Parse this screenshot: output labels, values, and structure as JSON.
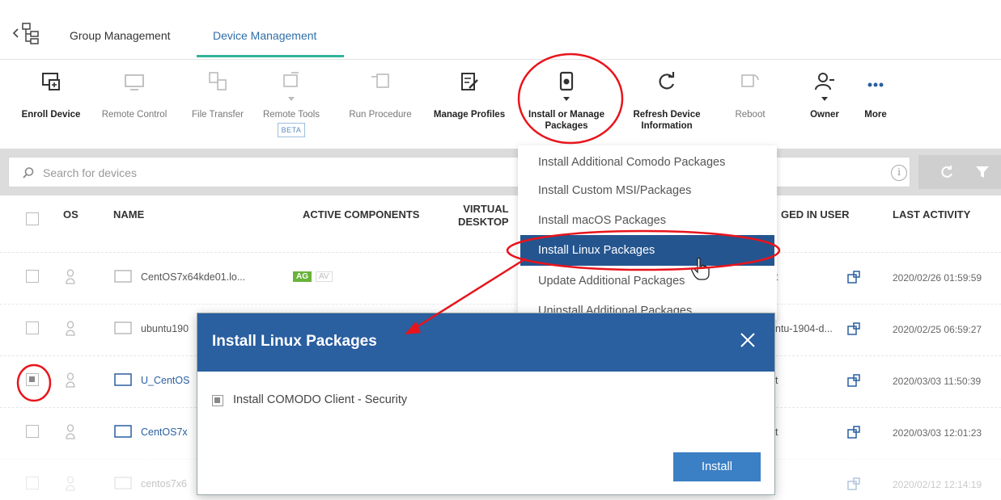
{
  "tabs": {
    "group": "Group Management",
    "device": "Device Management"
  },
  "toolbar": {
    "enroll": "Enroll Device",
    "remote_control": "Remote Control",
    "file_transfer": "File Transfer",
    "remote_tools": "Remote Tools",
    "beta": "BETA",
    "run_procedure": "Run Procedure",
    "manage_profiles": "Manage Profiles",
    "install_manage_1": "Install or Manage",
    "install_manage_2": "Packages",
    "refresh_1": "Refresh Device",
    "refresh_2": "Information",
    "reboot": "Reboot",
    "owner": "Owner",
    "more": "More"
  },
  "search": {
    "placeholder": "Search for devices",
    "info": "i"
  },
  "table": {
    "headers": {
      "os": "OS",
      "name": "NAME",
      "active_components": "ACTIVE COMPONENTS",
      "virtual_1": "VIRTUAL",
      "virtual_2": "DESKTOP",
      "logged_in_user": "GED IN USER",
      "last_activity": "LAST ACTIVITY"
    },
    "rows": [
      {
        "name": "CentOS7x64kde01.lo...",
        "ag": "AG",
        "av": "AV",
        "user": "t",
        "activity": "2020/02/26 01:59:59"
      },
      {
        "name": "ubuntu190",
        "user": "ntu-1904-d...",
        "activity": "2020/02/25 06:59:27"
      },
      {
        "name": "U_CentOS",
        "user": "t",
        "activity": "2020/03/03 11:50:39"
      },
      {
        "name": "CentOS7x",
        "user": "t",
        "activity": "2020/03/03 12:01:23"
      },
      {
        "name": "centos7x6",
        "user": "",
        "activity": "2020/02/12 12:14:19"
      }
    ]
  },
  "dropdown": {
    "items": [
      "Install Additional Comodo Packages",
      "Install Custom MSI/Packages",
      "Install macOS Packages",
      "Install Linux Packages",
      "Update Additional Packages",
      "Uninstall Additional Packages"
    ],
    "selected_index": 3
  },
  "modal": {
    "title": "Install Linux Packages",
    "option": "Install COMODO Client - Security",
    "button": "Install"
  },
  "colors": {
    "accent_tab": "#33b39a",
    "modal_header": "#2a5fa0",
    "selected_item": "#25558f",
    "button": "#3b7fc4",
    "annotation": "#e8141c"
  }
}
